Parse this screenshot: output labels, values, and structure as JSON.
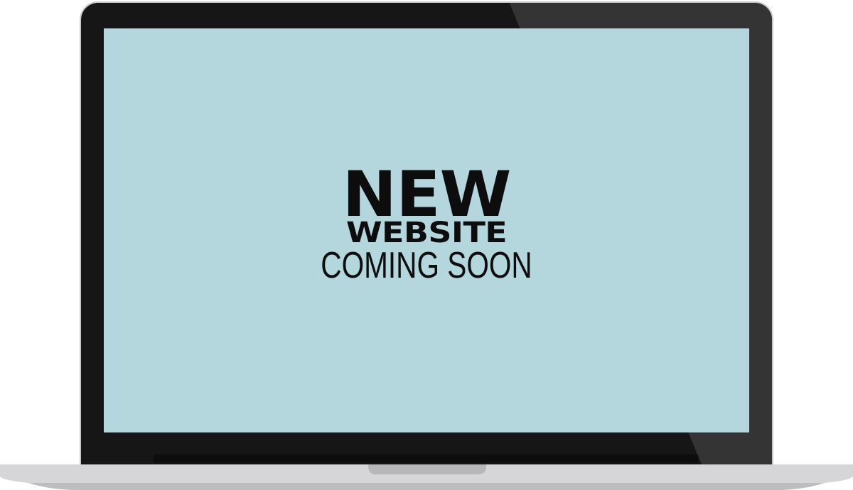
{
  "screen": {
    "headline_line1": "NEW",
    "headline_line2": "WEBSITE",
    "headline_line3": "COMING SOON"
  },
  "colors": {
    "screen_background": "#b3d7dc",
    "bezel": "#161616",
    "text": "#0d0d0d",
    "base": "#d6d6d8"
  }
}
